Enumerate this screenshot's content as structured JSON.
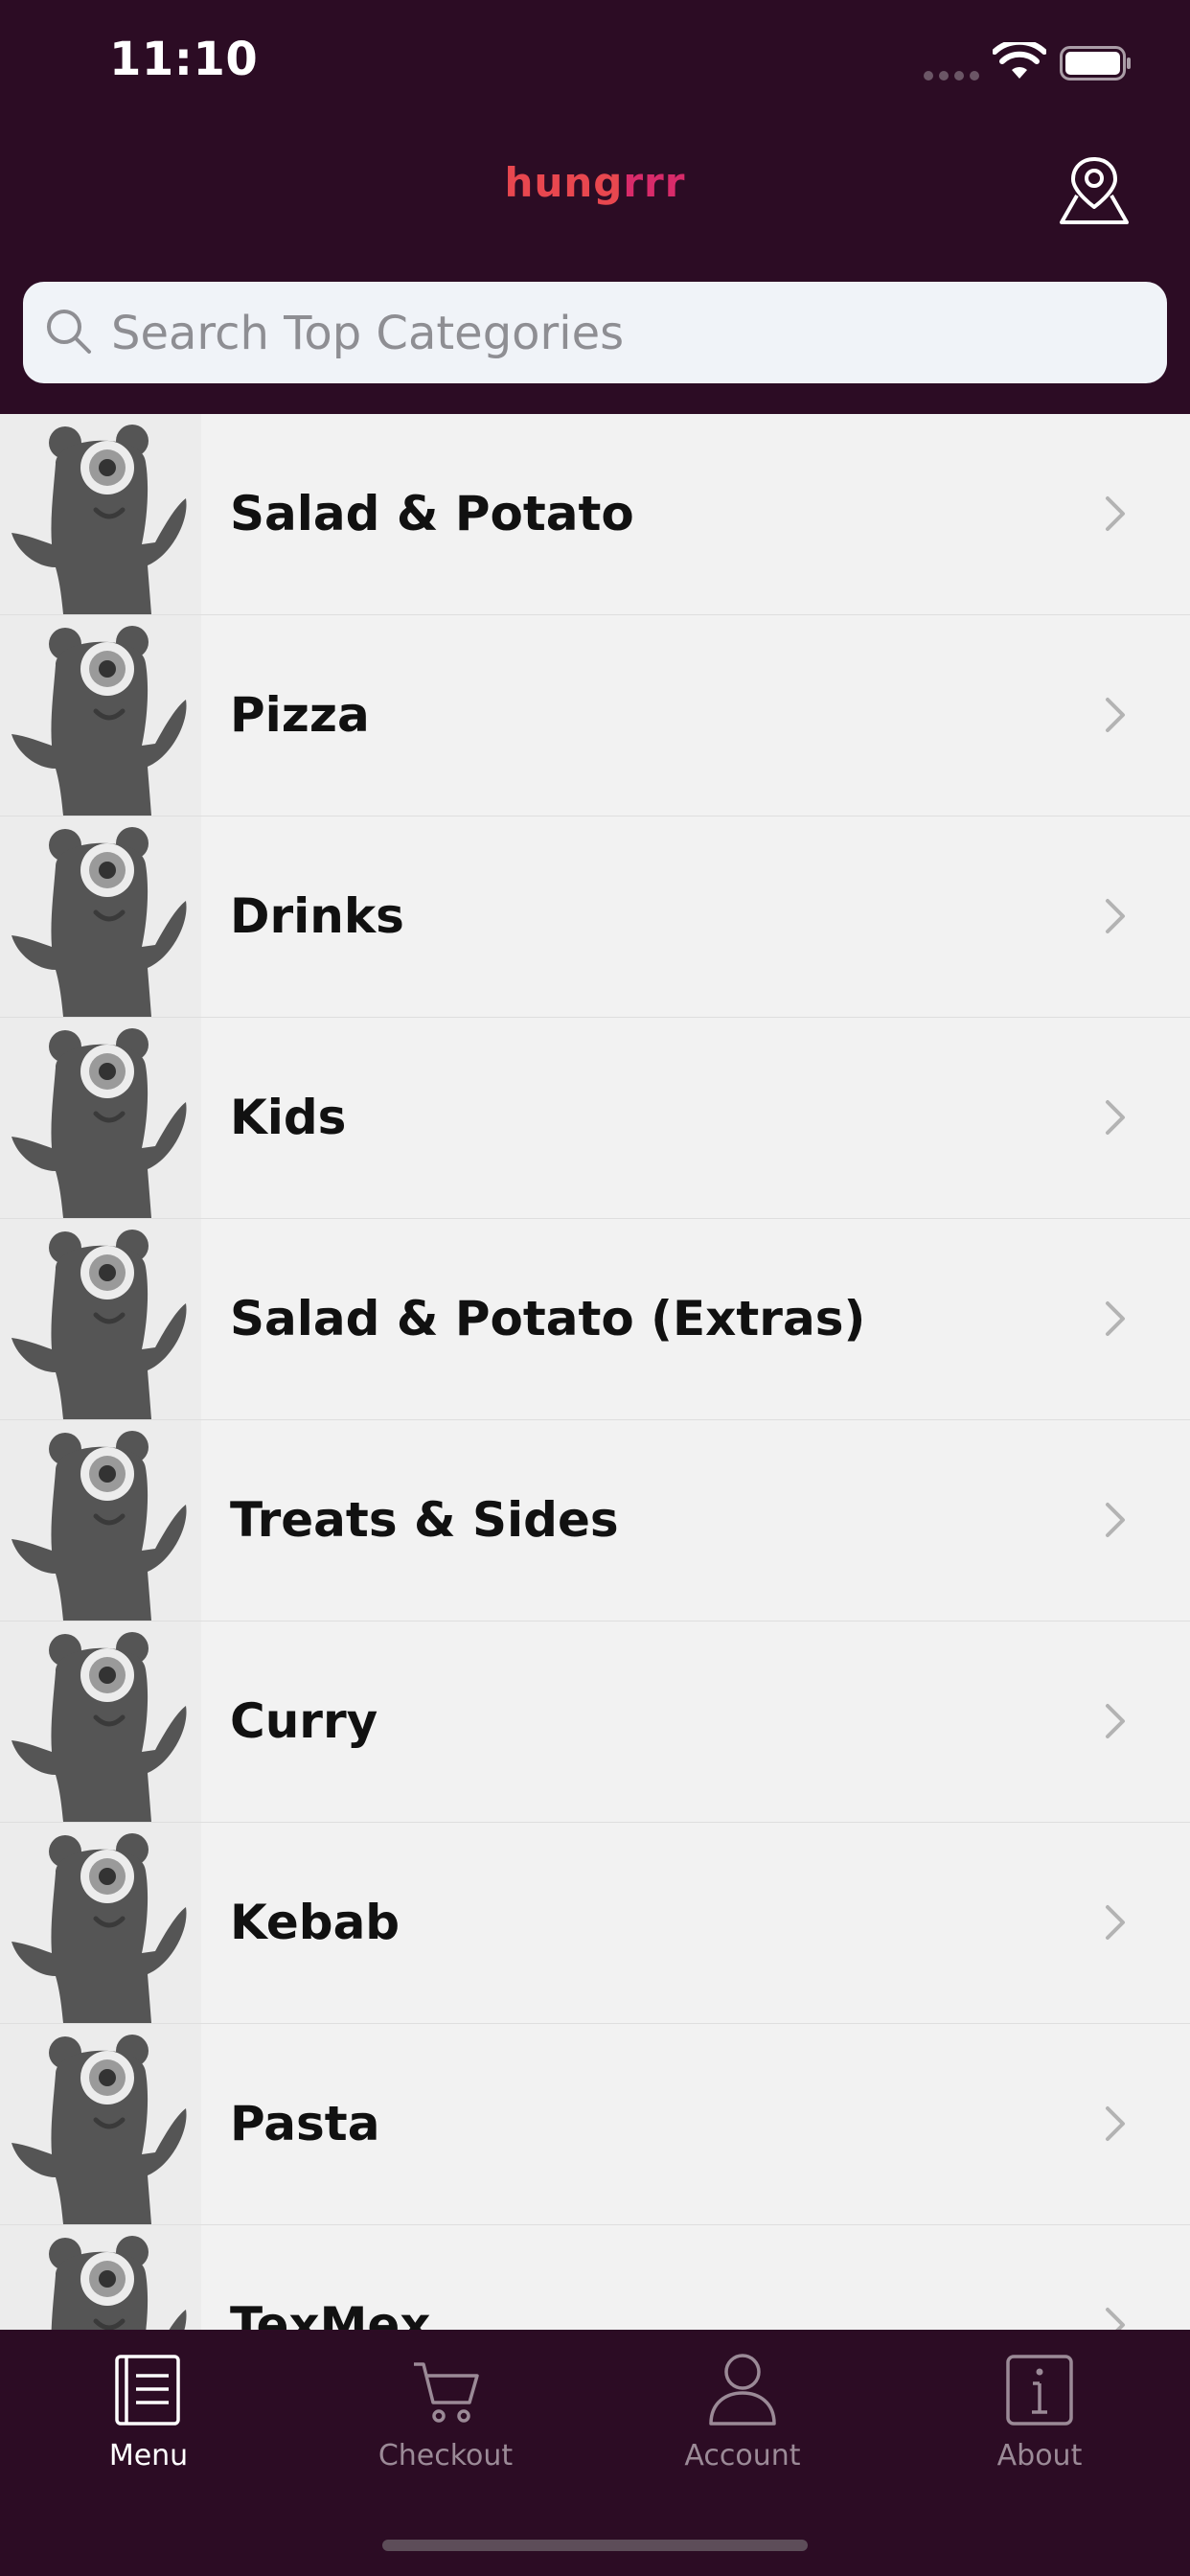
{
  "status_bar": {
    "time": "11:10"
  },
  "header": {
    "logo_prefix": "hung",
    "logo_suffix": "rrr"
  },
  "search": {
    "placeholder": "Search Top Categories",
    "value": ""
  },
  "categories": [
    {
      "label": "Salad & Potato"
    },
    {
      "label": "Pizza"
    },
    {
      "label": "Drinks"
    },
    {
      "label": "Kids"
    },
    {
      "label": "Salad & Potato (Extras)"
    },
    {
      "label": "Treats & Sides"
    },
    {
      "label": "Curry"
    },
    {
      "label": "Kebab"
    },
    {
      "label": "Pasta"
    },
    {
      "label": "TexMex"
    }
  ],
  "tab_bar": {
    "items": [
      {
        "label": "Menu",
        "icon": "menu-book-icon",
        "active": true
      },
      {
        "label": "Checkout",
        "icon": "cart-icon",
        "active": false
      },
      {
        "label": "Account",
        "icon": "person-icon",
        "active": false
      },
      {
        "label": "About",
        "icon": "info-icon",
        "active": false
      }
    ]
  },
  "colors": {
    "header_bg": "#2c0c24",
    "logo": "#e8474f",
    "list_bg": "#f2f2f2",
    "tab_active": "#ffffff",
    "tab_inactive": "#9b8a97"
  }
}
